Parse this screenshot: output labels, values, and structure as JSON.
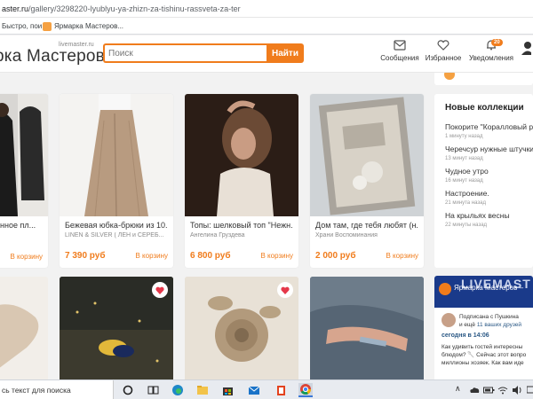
{
  "browser": {
    "url_host": "aster.ru",
    "url_path": "/gallery/3298220-lyublyu-ya-zhizn-za-tishinu-rassveta-za-ter",
    "bookmarks": [
      {
        "label": "Быстро, пои..."
      },
      {
        "label": "Ярмарка Мастеров..."
      }
    ]
  },
  "header": {
    "logo_small": "livemaster.ru",
    "logo": "рка Мастеров",
    "search_placeholder": "Поиск",
    "search_button": "Найти",
    "nav": {
      "messages": "Сообщения",
      "favorites": "Избранное",
      "notifications": "Уведомления",
      "notifications_count": "20"
    }
  },
  "products": [
    {
      "title": "азанное пл...",
      "seller": "",
      "price": "",
      "cart": "В корзину"
    },
    {
      "title": "Бежевая юбка-брюки из 10...",
      "seller": "LINEN & SILVER ( ЛЕН и СЕРЕБ...",
      "price": "7 390 руб",
      "cart": "В корзину"
    },
    {
      "title": "Топы: шелковый топ \"Нежн...",
      "seller": "Ангелина Груздева",
      "price": "6 800 руб",
      "cart": "В корзину"
    },
    {
      "title": "Дом там, где тебя любят (н...",
      "seller": "Храни Воспоминания",
      "price": "2 000 руб",
      "cart": "В корзину"
    }
  ],
  "side": {
    "title": "Новые коллекции",
    "collections": [
      {
        "title": "Покорите \"Коралловый ри",
        "date": "1 минуту назад"
      },
      {
        "title": "Черечсур нужные штучки",
        "date": "13 минут назад"
      },
      {
        "title": "Чудное утро",
        "date": "16 минут назад"
      },
      {
        "title": "Настроение.",
        "date": "21 минута назад"
      },
      {
        "title": "На крыльях весны",
        "date": "22 минуты назад"
      }
    ]
  },
  "vk": {
    "banner_big": "LIVEMAST",
    "name": "Ярмарка Мастеров –",
    "subscribed": "Подписана с Пушкина",
    "friends_prefix": "и ещё ",
    "friends_link": "11 ваших друзей",
    "today": "сегодня в 14:06",
    "text_line1": "Как удивить гостей интересны",
    "text_line2": "блюдом? 🥄 Сейчас этот вопро",
    "text_line3": "миллионы хозяек. Как вам иде"
  },
  "taskbar": {
    "search_text": "сь текст для поиска"
  },
  "colors": {
    "accent": "#f07c1c",
    "link": "#2a5885"
  }
}
